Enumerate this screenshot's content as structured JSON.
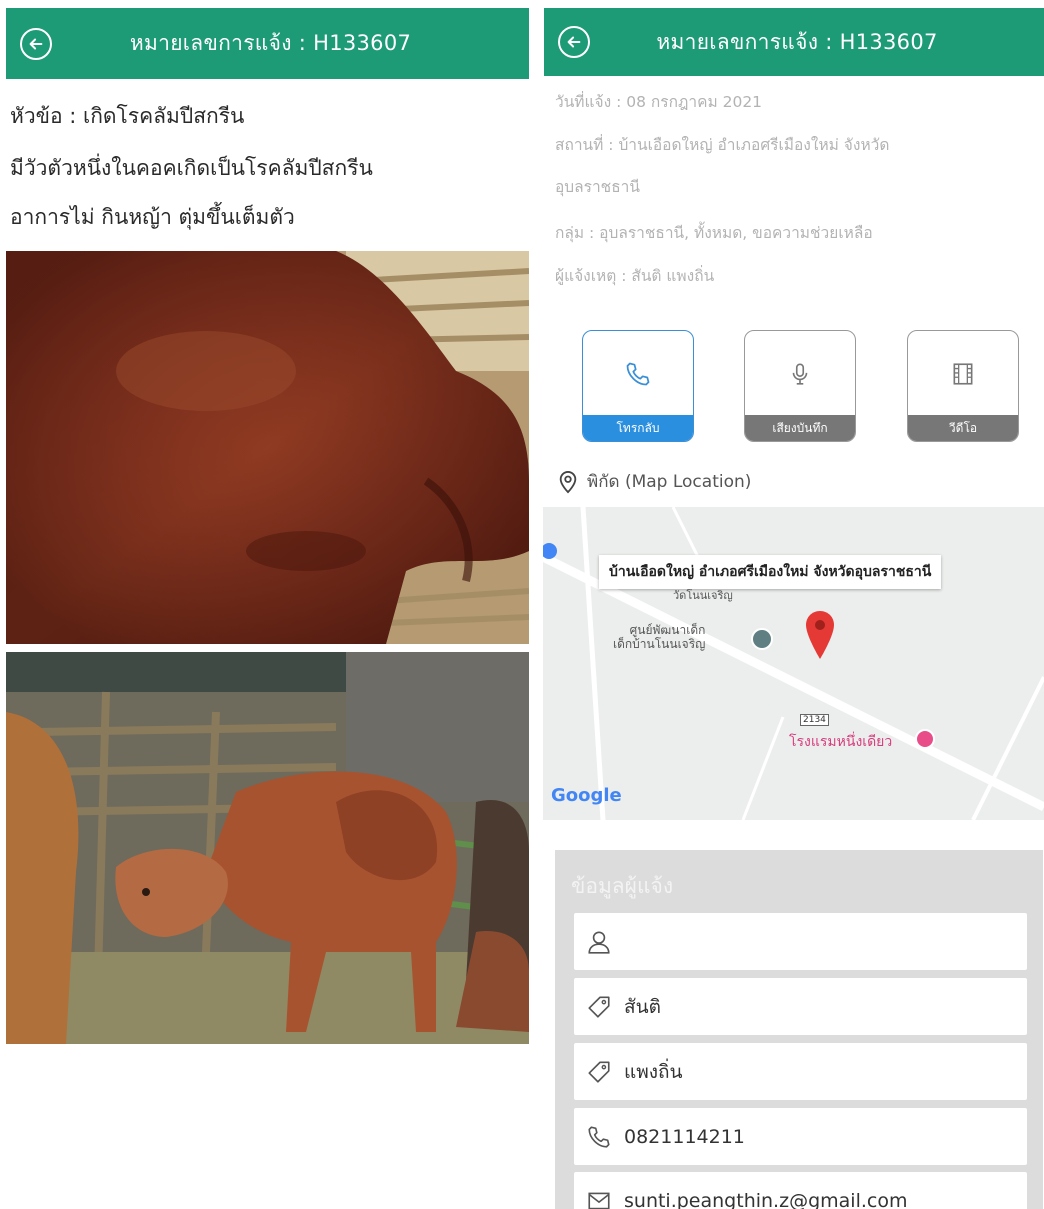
{
  "left": {
    "header": {
      "title": "หมายเลขการแจ้ง : H133607"
    },
    "subject": "หัวข้อ : เกิดโรคลัมปีสกรีน",
    "description_line1": "มีวัวตัวหนึ่งในคอคเกิดเป็นโรคลัมปีสกรีน",
    "description_line2": "อาการไม่ กินหญ้า ตุ่มขึ้นเต็มตัว"
  },
  "right": {
    "header": {
      "title": "หมายเลขการแจ้ง : H133607"
    },
    "report_date": "วันที่แจ้ง : 08 กรกฎาคม 2021",
    "location_line1": "สถานที่ : บ้านเอือดใหญ่ อำเภอศรีเมืองใหม่ จังหวัด",
    "location_line2": "อุบลราชธานี",
    "group": "กลุ่ม : อุบลราชธานี, ทั้งหมด, ขอความช่วยเหลือ",
    "reporter": "ผู้แจ้งเหตุ : สันติ แพงถิ่น",
    "media_buttons": [
      {
        "label": "โทรกลับ",
        "icon": "phone-icon",
        "active": true
      },
      {
        "label": "เสียงบันทึก",
        "icon": "microphone-icon",
        "active": false
      },
      {
        "label": "วีดีโอ",
        "icon": "film-icon",
        "active": false
      }
    ],
    "map_section_label": "พิกัด (Map Location)",
    "map": {
      "marker_label": "บ้านเอือดใหญ่ อำเภอศรีเมืองใหม่ จังหวัดอุบลราชธานี",
      "poi_school_line1": "ศูนย์พัฒนาเด็ก",
      "poi_school_line2": "เด็กบ้านโนนเจริญ",
      "poi_partial": "วัดโนนเจริญ",
      "road_number": "2134",
      "poi_hotel": "โรงแรมหนึ่งเดียว",
      "google_logo": "Google"
    },
    "reporter_panel": {
      "heading": "ข้อมูลผู้แจ้ง",
      "username": "",
      "first_name": "สันติ",
      "last_name": "แพงถิ่น",
      "phone": "0821114211",
      "email": "sunti.peangthin.z@gmail.com"
    },
    "colors": {
      "header": "#1d9a76",
      "active_button": "#2b8fe0",
      "marker": "#e53935",
      "hotel_pin": "#e84d8a"
    }
  }
}
